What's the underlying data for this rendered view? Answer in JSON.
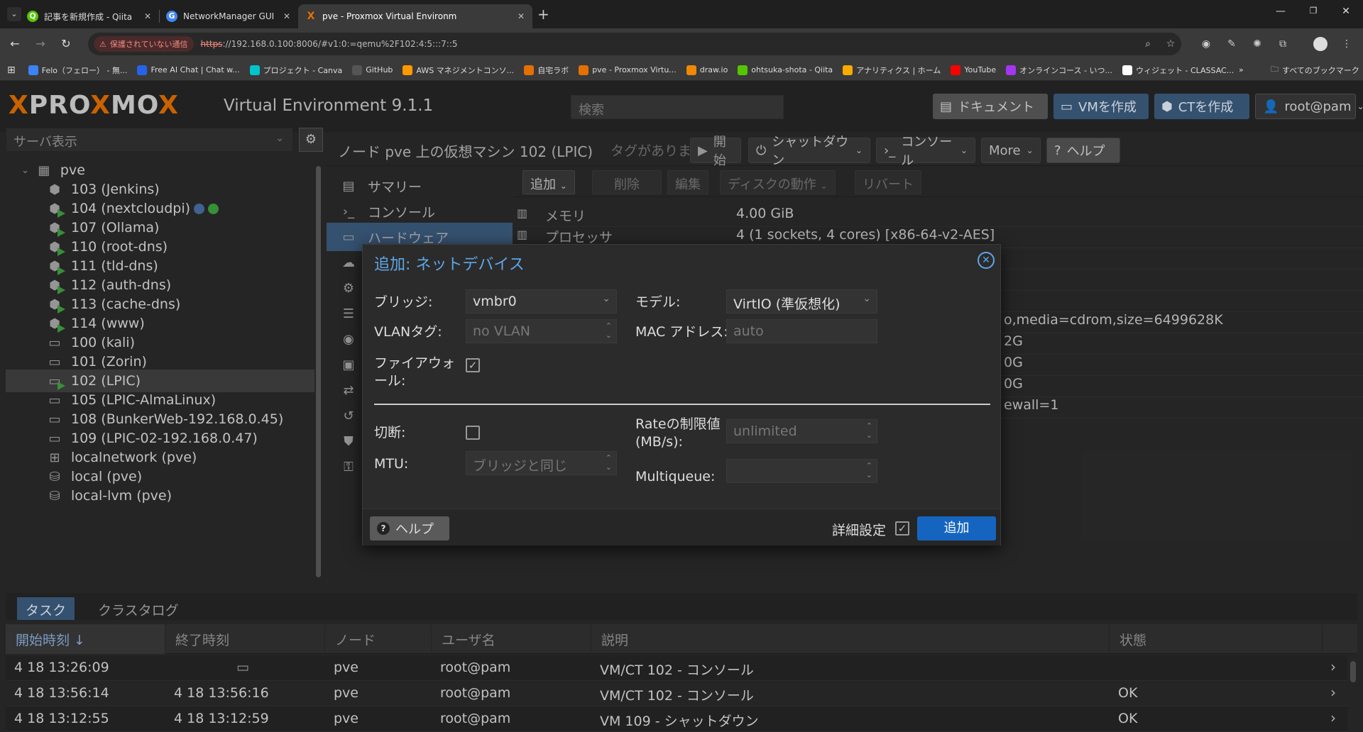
{
  "browser": {
    "tabs": [
      {
        "title": "記事を新規作成 - Qiita",
        "favicon": "Q",
        "color": "#55c500"
      },
      {
        "title": "NetworkManager GUI - Google",
        "favicon": "G",
        "color": "#4285f4"
      },
      {
        "title": "pve - Proxmox Virtual Environm",
        "favicon": "X",
        "color": "#e57000"
      }
    ],
    "insecure_label": "保護されていない通信",
    "url_proto": "https",
    "url_rest": "://192.168.0.100:8006/#v1:0:=qemu%2F102:4:5:::7::5",
    "bookmarks": [
      {
        "label": "Felo（フェロー） - 無...",
        "color": "#3b82f6"
      },
      {
        "label": "Free AI Chat | Chat w...",
        "color": "#2563eb"
      },
      {
        "label": "プロジェクト - Canva",
        "color": "#00c4cc"
      },
      {
        "label": "GitHub",
        "color": "#555555"
      },
      {
        "label": "AWS マネジメントコンソ...",
        "color": "#ff9900"
      },
      {
        "label": "自宅ラボ",
        "color": "#e57000"
      },
      {
        "label": "pve - Proxmox Virtu...",
        "color": "#e57000"
      },
      {
        "label": "draw.io",
        "color": "#f08705"
      },
      {
        "label": "ohtsuka-shota - Qiita",
        "color": "#55c500"
      },
      {
        "label": "アナリティクス | ホーム",
        "color": "#f9ab00"
      },
      {
        "label": "YouTube",
        "color": "#ff0000"
      },
      {
        "label": "オンラインコース - いつ...",
        "color": "#a435f0"
      },
      {
        "label": "ウィジェット - CLASSAC...",
        "color": "#ffffff"
      }
    ],
    "all_bookmarks": "すべてのブックマーク"
  },
  "pve": {
    "logo_a": "PRO",
    "logo_b": "X",
    "logo_c": "MO",
    "logo_d": "X",
    "version": "Virtual Environment 9.1.1",
    "search_placeholder": "検索",
    "docs": "ドキュメント",
    "create_vm": "VMを作成",
    "create_ct": "CTを作成",
    "user": "root@pam",
    "tree_view": "サーバ表示",
    "tree": [
      {
        "label": "pve",
        "type": "node",
        "level": 0
      },
      {
        "label": "103 (Jenkins)",
        "type": "ct",
        "level": 1
      },
      {
        "label": "104 (nextcloudpi)",
        "type": "ct-run",
        "level": 1,
        "tags": [
          "#4a6fa5",
          "#3fa33f"
        ]
      },
      {
        "label": "107 (Ollama)",
        "type": "ct-run",
        "level": 1
      },
      {
        "label": "110 (root-dns)",
        "type": "ct-run",
        "level": 1
      },
      {
        "label": "111 (tld-dns)",
        "type": "ct-run",
        "level": 1
      },
      {
        "label": "112 (auth-dns)",
        "type": "ct-run",
        "level": 1
      },
      {
        "label": "113 (cache-dns)",
        "type": "ct-run",
        "level": 1
      },
      {
        "label": "114 (www)",
        "type": "ct-run",
        "level": 1
      },
      {
        "label": "100 (kali)",
        "type": "vm",
        "level": 1
      },
      {
        "label": "101 (Zorin)",
        "type": "vm",
        "level": 1
      },
      {
        "label": "102 (LPIC)",
        "type": "vm-run",
        "level": 1,
        "selected": true
      },
      {
        "label": "105 (LPIC-AlmaLinux)",
        "type": "vm",
        "level": 1
      },
      {
        "label": "108 (BunkerWeb-192.168.0.45)",
        "type": "vm",
        "level": 1
      },
      {
        "label": "109 (LPIC-02-192.168.0.47)",
        "type": "vm",
        "level": 1
      },
      {
        "label": "localnetwork (pve)",
        "type": "net",
        "level": 1
      },
      {
        "label": "local (pve)",
        "type": "storage",
        "level": 1
      },
      {
        "label": "local-lvm (pve)",
        "type": "storage",
        "level": 1
      }
    ],
    "crumb": "ノード pve 上の仮想マシン 102 (LPIC)",
    "tags": "タグがありません",
    "start": "開始",
    "shutdown": "シャットダウン",
    "console": "コンソール",
    "more": "More",
    "help": "ヘルプ",
    "vmnav": [
      {
        "label": "サマリー",
        "icon": "book-icon"
      },
      {
        "label": "コンソール",
        "icon": "terminal-icon"
      },
      {
        "label": "ハードウェア",
        "icon": "monitor-icon",
        "selected": true
      },
      {
        "label": "",
        "icon": "cloud-icon"
      },
      {
        "label": "",
        "icon": "gear-icon"
      },
      {
        "label": "",
        "icon": "list-icon"
      },
      {
        "label": "",
        "icon": "eye-icon"
      },
      {
        "label": "",
        "icon": "floppy-icon"
      },
      {
        "label": "",
        "icon": "exchange-icon"
      },
      {
        "label": "",
        "icon": "history-icon"
      },
      {
        "label": "",
        "icon": "shield-icon"
      },
      {
        "label": "",
        "icon": "unlock-icon"
      }
    ],
    "hw_buttons": [
      "追加",
      "削除",
      "編集",
      "ディスクの動作",
      "リバート"
    ],
    "hw_rows": [
      {
        "label": "メモリ",
        "value": "4.00 GiB"
      },
      {
        "label": "プロセッサ",
        "value": "4 (1 sockets, 4 cores) [x86-64-v2-AES]"
      },
      {
        "label": "",
        "value": ""
      },
      {
        "label": "",
        "value": ""
      },
      {
        "label": "",
        "value": ""
      },
      {
        "label": "",
        "value": "o,media=cdrom,size=6499628K"
      },
      {
        "label": "",
        "value": "2G"
      },
      {
        "label": "",
        "value": "0G"
      },
      {
        "label": "",
        "value": "0G"
      },
      {
        "label": "",
        "value": "ewall=1"
      }
    ],
    "task_tabs": [
      "タスク",
      "クラスタログ"
    ],
    "task_headers": [
      "開始時刻 ↓",
      "終了時刻",
      "ノード",
      "ユーザ名",
      "説明",
      "状態"
    ],
    "tasks": [
      {
        "start": "4 18 13:26:09",
        "end": "",
        "node": "pve",
        "user": "root@pam",
        "desc": "VM/CT 102 - コンソール",
        "status": ""
      },
      {
        "start": "4 18 13:56:14",
        "end": "4 18 13:56:16",
        "node": "pve",
        "user": "root@pam",
        "desc": "VM/CT 102 - コンソール",
        "status": "OK"
      },
      {
        "start": "4 18 13:12:55",
        "end": "4 18 13:12:59",
        "node": "pve",
        "user": "root@pam",
        "desc": "VM 109 - シャットダウン",
        "status": "OK"
      }
    ]
  },
  "dialog": {
    "title": "追加: ネットデバイス",
    "bridge_label": "ブリッジ:",
    "bridge_value": "vmbr0",
    "model_label": "モデル:",
    "model_value": "VirtIO (準仮想化)",
    "vlan_label": "VLANタグ:",
    "vlan_placeholder": "no VLAN",
    "mac_label": "MAC アドレス:",
    "mac_placeholder": "auto",
    "firewall_label": "ファイアウォール:",
    "firewall_checked": true,
    "disconnect_label": "切断:",
    "disconnect_checked": false,
    "rate_label": "Rateの制限値 (MB/s):",
    "rate_placeholder": "unlimited",
    "mtu_label": "MTU:",
    "mtu_placeholder": "ブリッジと同じ",
    "multiqueue_label": "Multiqueue:",
    "multiqueue_value": "",
    "help": "ヘルプ",
    "advanced": "詳細設定",
    "advanced_checked": true,
    "add": "追加"
  }
}
